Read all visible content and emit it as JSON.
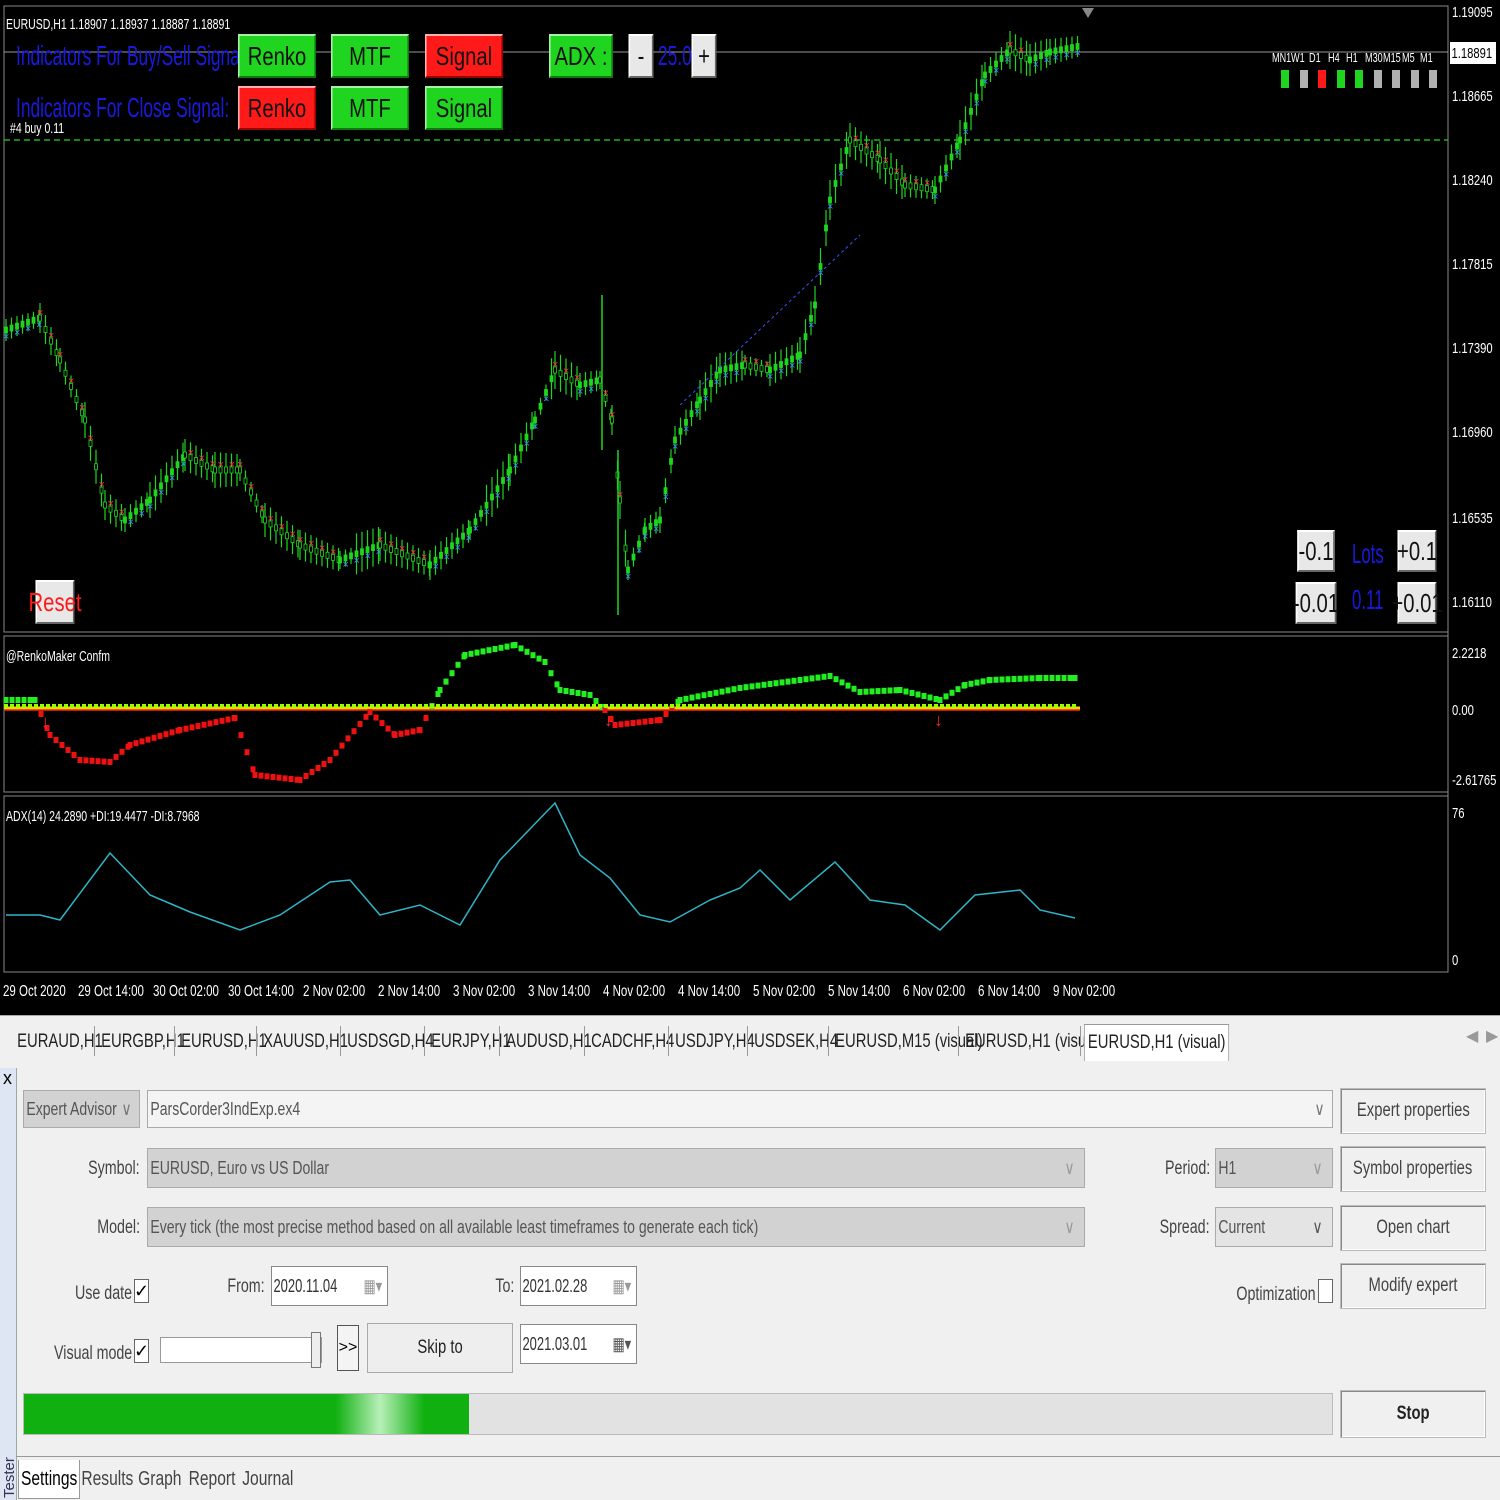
{
  "chart": {
    "header": "EURUSD,H1  1.18907 1.18937 1.18887 1.18891",
    "buy_sell_label": "Indicators For Buy/Sell Signal:",
    "close_label": "Indicators For Close Signal:",
    "order_label": "#4 buy 0.11",
    "row1_buttons": [
      "Renko",
      "MTF",
      "Signal"
    ],
    "row2_buttons": [
      "Renko",
      "MTF",
      "Signal"
    ],
    "adx_label": "ADX :",
    "adx_minus": "-",
    "adx_value": "25.0",
    "adx_plus": "+",
    "timeframes": [
      "MN1",
      "W1",
      "D1",
      "H4",
      "H1",
      "M30",
      "M15",
      "M5",
      "M1"
    ],
    "timeframe_colors": [
      "#1fd51f",
      "#b0b0b0",
      "#ff1a1a",
      "#1fd51f",
      "#1fd51f",
      "#b0b0b0",
      "#b0b0b0",
      "#b0b0b0",
      "#b0b0b0"
    ],
    "reset_label": "Reset",
    "lots_label": "Lots",
    "lots_value": "0.11",
    "lot_buttons": {
      "m01": "-0.1",
      "p01": "+0.1",
      "m001": "-0.01",
      "p001": "+0.01"
    },
    "price_ticks": [
      "1.19095",
      "1.18665",
      "1.18240",
      "1.17815",
      "1.17390",
      "1.16960",
      "1.16535",
      "1.16110"
    ],
    "current_price": "1.18891",
    "renko_title": "@RenkoMaker Confm",
    "renko_ticks": [
      "2.2218",
      "0.00",
      "-2.61765"
    ],
    "adx_title": "ADX(14) 24.2890 +DI:19.4477 -DI:8.7968",
    "adx_ticks": [
      "76",
      "0"
    ],
    "time_ticks": [
      "29 Oct 2020",
      "29 Oct 14:00",
      "30 Oct 02:00",
      "30 Oct 14:00",
      "2 Nov 02:00",
      "2 Nov 14:00",
      "3 Nov 02:00",
      "3 Nov 14:00",
      "4 Nov 02:00",
      "4 Nov 14:00",
      "5 Nov 02:00",
      "5 Nov 14:00",
      "6 Nov 02:00",
      "6 Nov 14:00",
      "9 Nov 02:00"
    ]
  },
  "tabs": [
    "EURAUD,H1",
    "EURGBP,H1",
    "EURUSD,H1",
    "XAUUSD,H1",
    "USDSGD,H4",
    "EURJPY,H1",
    "AUDUSD,H1",
    "CADCHF,H4",
    "USDJPY,H4",
    "USDSEK,H4",
    "EURUSD,M15 (visual)",
    "EURUSD,H1 (visual)",
    "EURUSD,H1 (visual)"
  ],
  "tester": {
    "close": "x",
    "side_label": "Tester",
    "type": "Expert Advisor",
    "ea_file": "ParsCorder3IndExp.ex4",
    "symbol_label": "Symbol:",
    "symbol": "EURUSD, Euro vs US Dollar",
    "model_label": "Model:",
    "model": "Every tick (the most precise method based on all available least timeframes to generate each tick)",
    "period_label": "Period:",
    "period": "H1",
    "spread_label": "Spread:",
    "spread": "Current",
    "use_date_label": "Use date",
    "from_label": "From:",
    "from": "2020.11.04",
    "to_label": "To:",
    "to": "2021.02.28",
    "optimization_label": "Optimization",
    "visual_mode_label": "Visual mode",
    "skip_arrow": ">>",
    "skip_to_label": "Skip to",
    "skip_date": "2021.03.01",
    "progress": 0.34,
    "buttons": [
      "Expert properties",
      "Symbol properties",
      "Open chart",
      "Modify expert"
    ],
    "stop_label": "Stop",
    "check_mark": "✓",
    "bottom_tabs": [
      "Settings",
      "Results",
      "Graph",
      "Report",
      "Journal"
    ]
  }
}
